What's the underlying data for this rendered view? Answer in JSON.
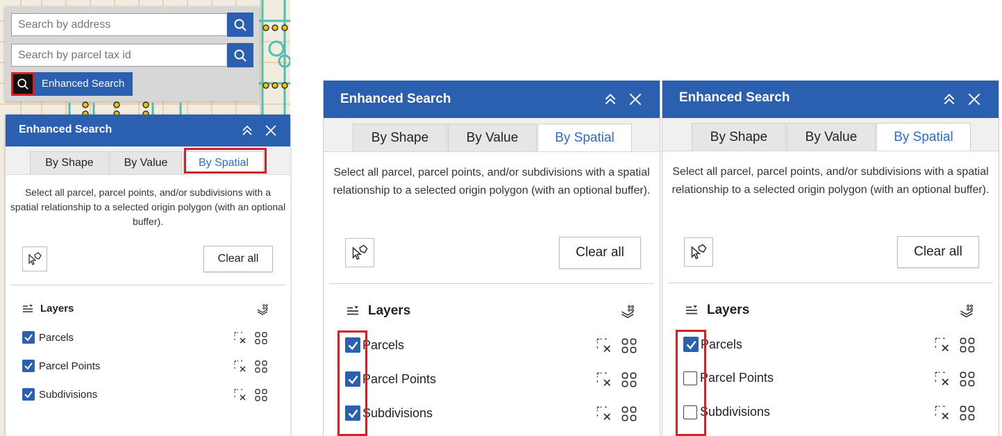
{
  "search": {
    "address_placeholder": "Search by address",
    "parcel_placeholder": "Search by parcel tax id",
    "enhanced_label": "Enhanced Search"
  },
  "panel": {
    "title": "Enhanced Search",
    "tabs": [
      "By Shape",
      "By Value",
      "By Spatial"
    ],
    "active_tab": "By Spatial",
    "description": "Select all parcel, parcel points, and/or subdivisions with a spatial relationship to a selected origin polygon (with an optional buffer).",
    "clear_all": "Clear all",
    "layers_title": "Layers",
    "layers": [
      "Parcels",
      "Parcel Points",
      "Subdivisions"
    ]
  },
  "panel_states": {
    "left": [
      true,
      true,
      true
    ],
    "middle": [
      true,
      true,
      true
    ],
    "right": [
      true,
      false,
      false
    ]
  },
  "colors": {
    "header_blue": "#2b5fb0",
    "active_tab_text": "#2e6bc4",
    "highlight_red": "#d91f26"
  },
  "icons": {
    "search": "search-icon",
    "collapse": "double-chevron-up-icon",
    "close": "close-icon",
    "select_tool": "pointer-polygon-icon",
    "layers_toggle": "layers-list-icon",
    "layer_options": "layers-stack-icon",
    "clear_selection": "clear-selection-icon",
    "view_table": "grid-icon"
  }
}
